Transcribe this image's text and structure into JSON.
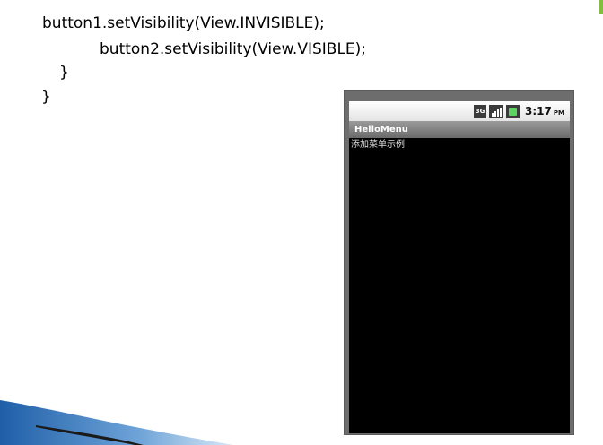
{
  "code": {
    "line1": "button1.setVisibility(View.INVISIBLE);",
    "line2": "button2.setVisibility(View.VISIBLE);",
    "line3": "}",
    "line4": "}"
  },
  "phone": {
    "status_bar": {
      "network_label": "3G",
      "time": "3:17",
      "ampm": "PM"
    },
    "app_title": "HelloMenu",
    "content_text": "添加菜单示例"
  }
}
